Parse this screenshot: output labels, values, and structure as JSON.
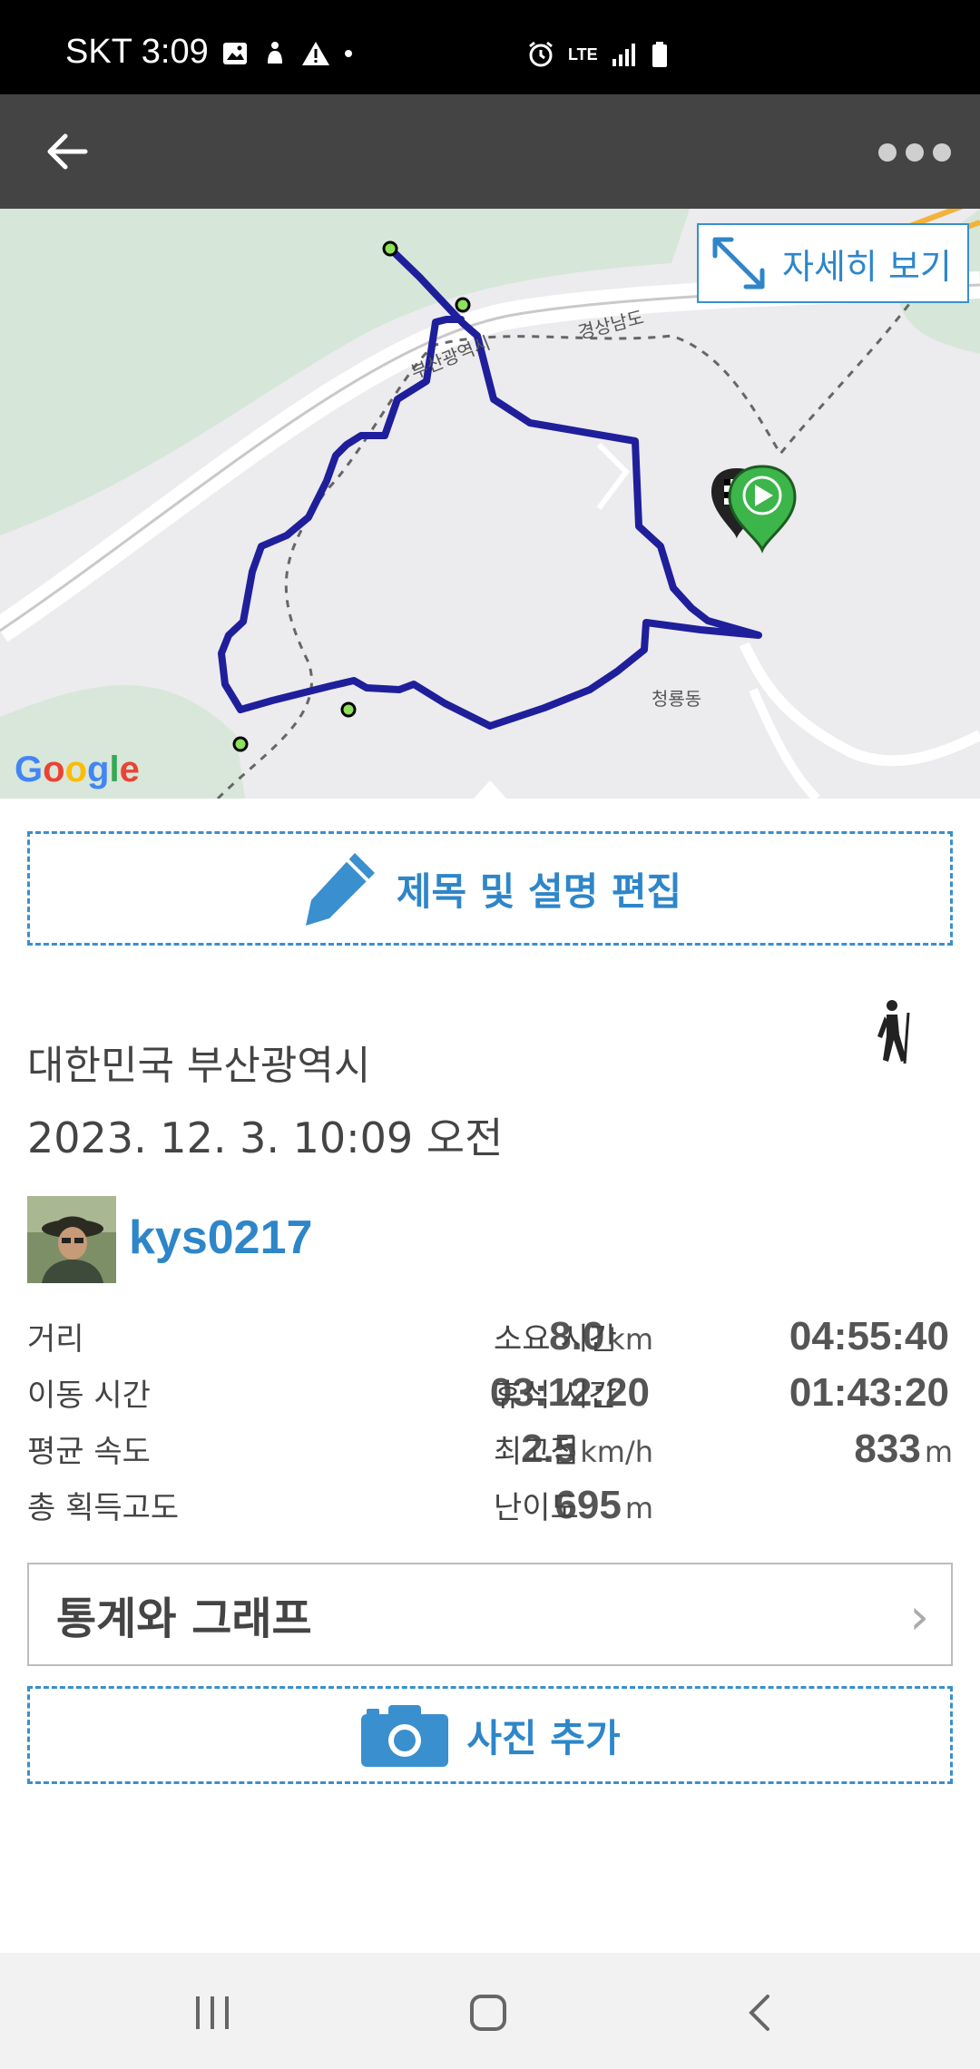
{
  "status_bar": {
    "carrier_time": "SKT 3:09",
    "notification_icons": [
      "image-icon",
      "accessibility-icon",
      "warning-icon",
      "dot-icon"
    ],
    "system_icons": [
      "alarm-icon",
      "lte-icon",
      "signal-icon",
      "battery-icon"
    ],
    "network": "LTE"
  },
  "app_bar": {
    "back_icon": "back-arrow-icon",
    "more_icon": "more-dots-icon"
  },
  "map": {
    "expand_label": "자세히 보기",
    "labels": {
      "busan": "부산광역시",
      "gyeongnam": "경상남도",
      "cheongryong": "청룡동"
    },
    "google_logo": "Google",
    "track_color": "#1f1f9c"
  },
  "edit": {
    "label": "제목 및 설명 편집"
  },
  "activity": {
    "location": "대한민국 부산광역시",
    "datetime": "2023. 12. 3. 10:09 오전",
    "type_icon": "hiking-icon"
  },
  "user": {
    "username": "kys0217"
  },
  "stats": [
    {
      "label": "거리",
      "value": "8.0",
      "unit": "km",
      "label2": "소요 시간",
      "value2": "04:55:40",
      "unit2": ""
    },
    {
      "label": "이동 시간",
      "value": "03:12:20",
      "unit": "",
      "label2": "휴식 시간",
      "value2": "01:43:20",
      "unit2": ""
    },
    {
      "label": "평균 속도",
      "value": "2.5",
      "unit": "km/h",
      "label2": "최고점",
      "value2": "833",
      "unit2": "m"
    },
    {
      "label": "총 획득고도",
      "value": "695",
      "unit": "m",
      "label2": "난이도",
      "value2": "",
      "unit2": ""
    }
  ],
  "stats_button": {
    "label": "통계와 그래프",
    "chevron": "›"
  },
  "photo": {
    "label": "사진 추가"
  },
  "colors": {
    "accent": "#2e86c9",
    "app_bar": "#444444",
    "track": "#1f1f9c"
  }
}
